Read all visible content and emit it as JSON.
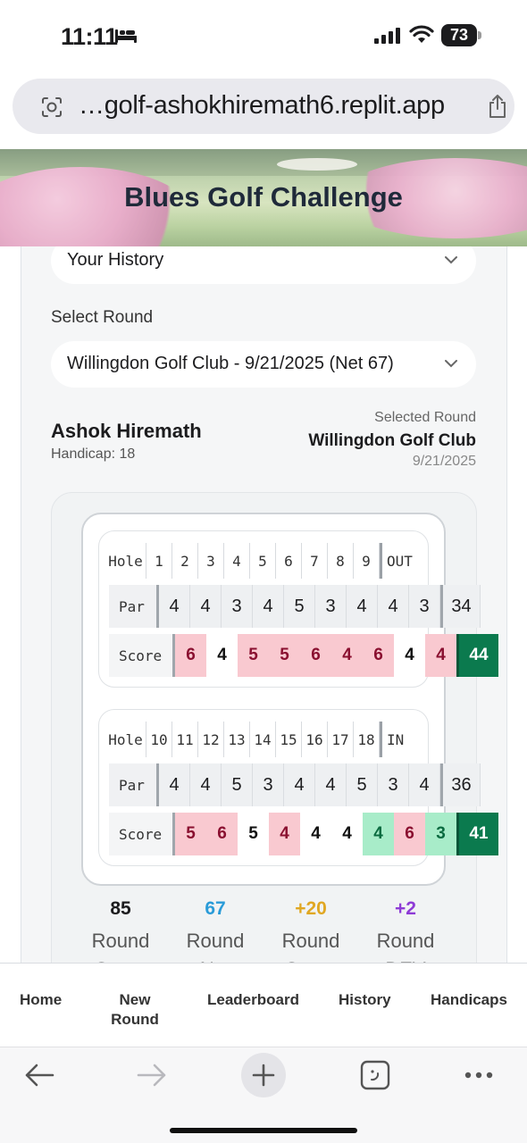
{
  "status_bar": {
    "time": "11:11",
    "battery": "73"
  },
  "browser": {
    "url": "…golf-ashokhiremath6.replit.app"
  },
  "header": {
    "title": "Blues Golf Challenge"
  },
  "history_select": {
    "value": "Your History"
  },
  "round_select": {
    "label": "Select Round",
    "value": "Willingdon Golf Club - 9/21/2025 (Net 67)"
  },
  "player": {
    "name": "Ashok Hiremath",
    "handicap": "Handicap: 18"
  },
  "selected_round": {
    "caption": "Selected Round",
    "club": "Willingdon Golf Club",
    "date": "9/21/2025"
  },
  "scorecard": {
    "hole_label": "Hole",
    "par_label": "Par",
    "score_label": "Score",
    "front": {
      "holes": [
        "1",
        "2",
        "3",
        "4",
        "5",
        "6",
        "7",
        "8",
        "9"
      ],
      "total_label": "OUT",
      "par": [
        "4",
        "4",
        "3",
        "4",
        "5",
        "3",
        "4",
        "4",
        "3"
      ],
      "par_total": "34",
      "score": [
        "6",
        "4",
        "5",
        "5",
        "6",
        "4",
        "6",
        "4",
        "4"
      ],
      "score_total": "44",
      "score_type": [
        "bogey",
        "par",
        "bogey",
        "bogey",
        "bogey",
        "bogey",
        "bogey",
        "par",
        "bogey"
      ]
    },
    "back": {
      "holes": [
        "10",
        "11",
        "12",
        "13",
        "14",
        "15",
        "16",
        "17",
        "18"
      ],
      "total_label": "IN",
      "par": [
        "4",
        "4",
        "5",
        "3",
        "4",
        "4",
        "5",
        "3",
        "4"
      ],
      "par_total": "36",
      "score": [
        "5",
        "6",
        "5",
        "4",
        "4",
        "4",
        "4",
        "6",
        "3"
      ],
      "score_total": "41",
      "score_type": [
        "bogey",
        "bogey",
        "par",
        "bogey",
        "par",
        "par",
        "birdie",
        "bogey",
        "birdie"
      ]
    }
  },
  "stats": [
    {
      "value": "85",
      "label": "Round",
      "label2": "Score",
      "color": "#1c1c1e"
    },
    {
      "value": "67",
      "label": "Round",
      "label2": "Net",
      "color": "#2a9bd8"
    },
    {
      "value": "+20",
      "label": "Round",
      "label2": "Score",
      "color": "#e0a722"
    },
    {
      "value": "+2",
      "label": "Round",
      "label2": "DEV",
      "color": "#8e3bd6"
    }
  ],
  "nav": {
    "home": "Home",
    "new_round_1": "New",
    "new_round_2": "Round",
    "leaderboard": "Leaderboard",
    "history": "History",
    "handicaps": "Handicaps"
  },
  "icons": {
    "status": [
      "bed-icon",
      "signal-icon",
      "wifi-icon"
    ],
    "toolbar": [
      "back-arrow-icon",
      "forward-arrow-icon",
      "plus-icon",
      "tabs-icon",
      "more-icon"
    ]
  }
}
